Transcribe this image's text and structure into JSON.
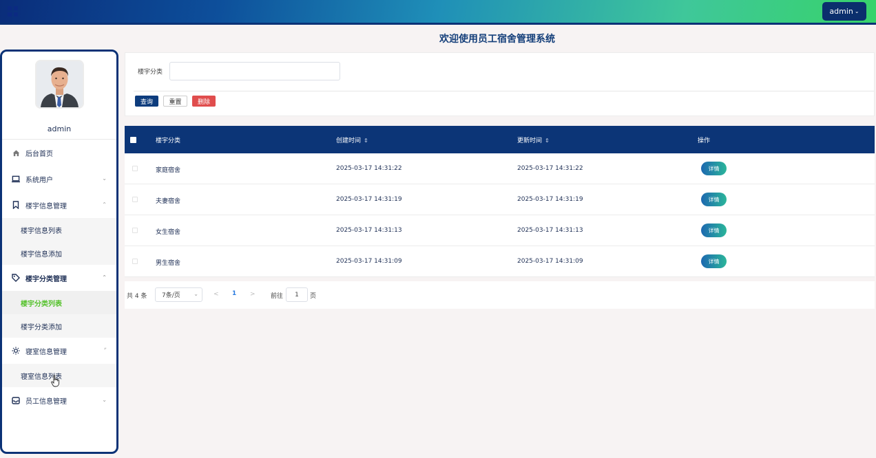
{
  "header": {
    "user_button": "admin",
    "user_chevron": "⌄"
  },
  "page_title": "欢迎使用员工宿舍管理系统",
  "sidebar": {
    "admin_name": "admin",
    "menu": [
      {
        "label": "后台首页",
        "icon": "home-icon"
      },
      {
        "label": "系统用户",
        "icon": "laptop-icon",
        "arrow": "⌄"
      },
      {
        "label": "楼宇信息管理",
        "icon": "bookmark-icon",
        "arrow": "⌃",
        "children": [
          "楼宇信息列表",
          "楼宇信息添加"
        ]
      },
      {
        "label": "楼宇分类管理",
        "icon": "tag-icon",
        "arrow": "⌃",
        "children": [
          "楼宇分类列表",
          "楼宇分类添加"
        ]
      },
      {
        "label": "寝室信息管理",
        "icon": "sun-icon",
        "arrow": "⌜",
        "children": [
          "寝室信息列表"
        ]
      },
      {
        "label": "员工信息管理",
        "icon": "inbox-icon",
        "arrow": "⌄"
      }
    ]
  },
  "search": {
    "label": "楼宇分类",
    "value": "",
    "query_btn": "查询",
    "reset_btn": "重置",
    "delete_btn": "删除"
  },
  "table": {
    "columns": [
      "楼宇分类",
      "创建时间",
      "更新时间",
      "操作"
    ],
    "sort_glyph": "⇕",
    "rows": [
      {
        "category": "家庭宿舍",
        "created": "2025-03-17 14:31:22",
        "updated": "2025-03-17 14:31:22",
        "action": "详情"
      },
      {
        "category": "夫妻宿舍",
        "created": "2025-03-17 14:31:19",
        "updated": "2025-03-17 14:31:19",
        "action": "详情"
      },
      {
        "category": "女生宿舍",
        "created": "2025-03-17 14:31:13",
        "updated": "2025-03-17 14:31:13",
        "action": "详情"
      },
      {
        "category": "男生宿舍",
        "created": "2025-03-17 14:31:09",
        "updated": "2025-03-17 14:31:09",
        "action": "详情"
      }
    ]
  },
  "pager": {
    "total": "共 4 条",
    "page_size": "7条/页",
    "prev": "<",
    "current": "1",
    "next": ">",
    "goto_label": "前往",
    "goto_value": "1",
    "goto_unit": "页"
  }
}
